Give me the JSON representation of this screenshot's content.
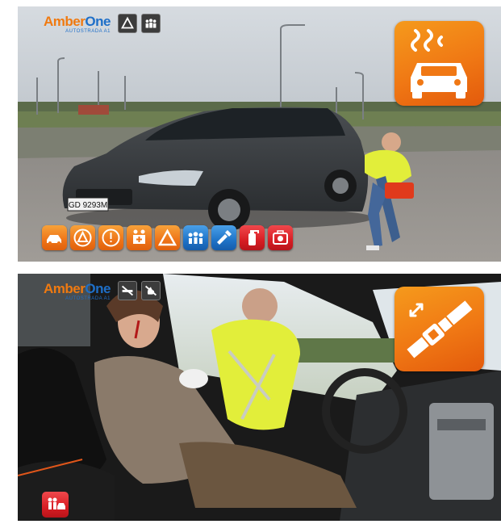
{
  "panel_top": {
    "logo": {
      "brand_prefix": "Amber",
      "brand_suffix": "One",
      "subtitle": "AUTOSTRADA A1"
    },
    "license_plate": "GD 9293M",
    "top_buttons": [
      "warning-triangle-icon",
      "people-group-icon"
    ],
    "big_icon": "car-fumes-icon",
    "toolbar": [
      {
        "icon": "car-crash-icon",
        "color": "orange"
      },
      {
        "icon": "warning-triangle-circle-icon",
        "color": "orange"
      },
      {
        "icon": "exclamation-circle-icon",
        "color": "orange"
      },
      {
        "icon": "first-aid-people-icon",
        "color": "orange"
      },
      {
        "icon": "warning-triangle-icon",
        "color": "orange"
      },
      {
        "icon": "people-group-icon",
        "color": "blue"
      },
      {
        "icon": "flashlight-icon",
        "color": "blue"
      },
      {
        "icon": "fire-extinguisher-icon",
        "color": "red"
      },
      {
        "icon": "first-aid-kit-icon",
        "color": "red"
      }
    ],
    "colors": {
      "orange": "#f07814",
      "blue": "#1f74c8",
      "red": "#d81e24"
    }
  },
  "panel_bottom": {
    "logo": {
      "brand_prefix": "Amber",
      "brand_suffix": "One",
      "subtitle": "AUTOSTRADA A1"
    },
    "top_buttons": [
      "no-smoking-icon",
      "no-fire-icon"
    ],
    "big_icon": "seatbelt-unbuckle-icon",
    "bottom_button": {
      "icon": "people-car-icon",
      "color": "red"
    }
  }
}
